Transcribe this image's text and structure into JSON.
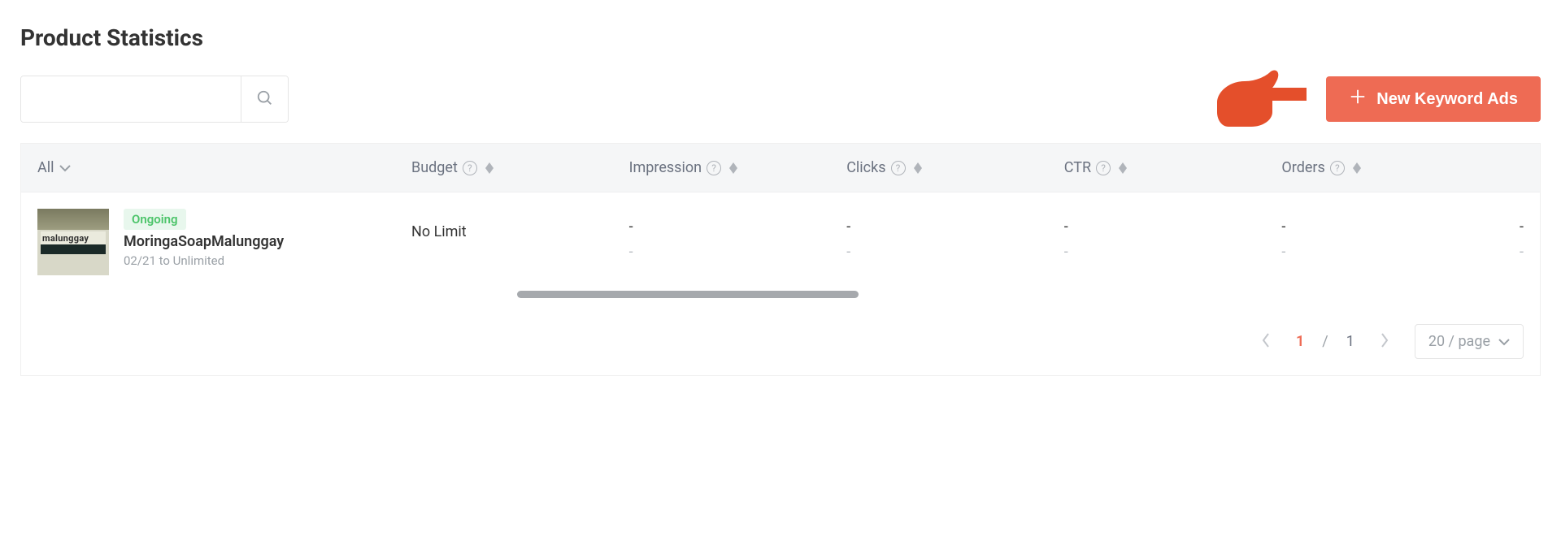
{
  "header": {
    "title": "Product Statistics"
  },
  "search": {
    "value": "",
    "placeholder": ""
  },
  "actions": {
    "new_keyword_ads": "New Keyword Ads"
  },
  "table": {
    "filter_label": "All",
    "columns": {
      "budget": "Budget",
      "impression": "Impression",
      "clicks": "Clicks",
      "ctr": "CTR",
      "orders": "Orders"
    },
    "rows": [
      {
        "status": "Ongoing",
        "name": "MoringaSoapMalunggay",
        "date_range": "02/21 to Unlimited",
        "thumb_text": "malunggay",
        "budget": "No Limit",
        "impression_top": "-",
        "impression_bottom": "-",
        "clicks_top": "-",
        "clicks_bottom": "-",
        "ctr_top": "-",
        "ctr_bottom": "-",
        "orders_top": "-",
        "orders_bottom": "-",
        "extra_top": "-",
        "extra_bottom": "-"
      }
    ]
  },
  "pagination": {
    "current": "1",
    "separator": "/",
    "total": "1",
    "page_size_label": "20 / page"
  }
}
